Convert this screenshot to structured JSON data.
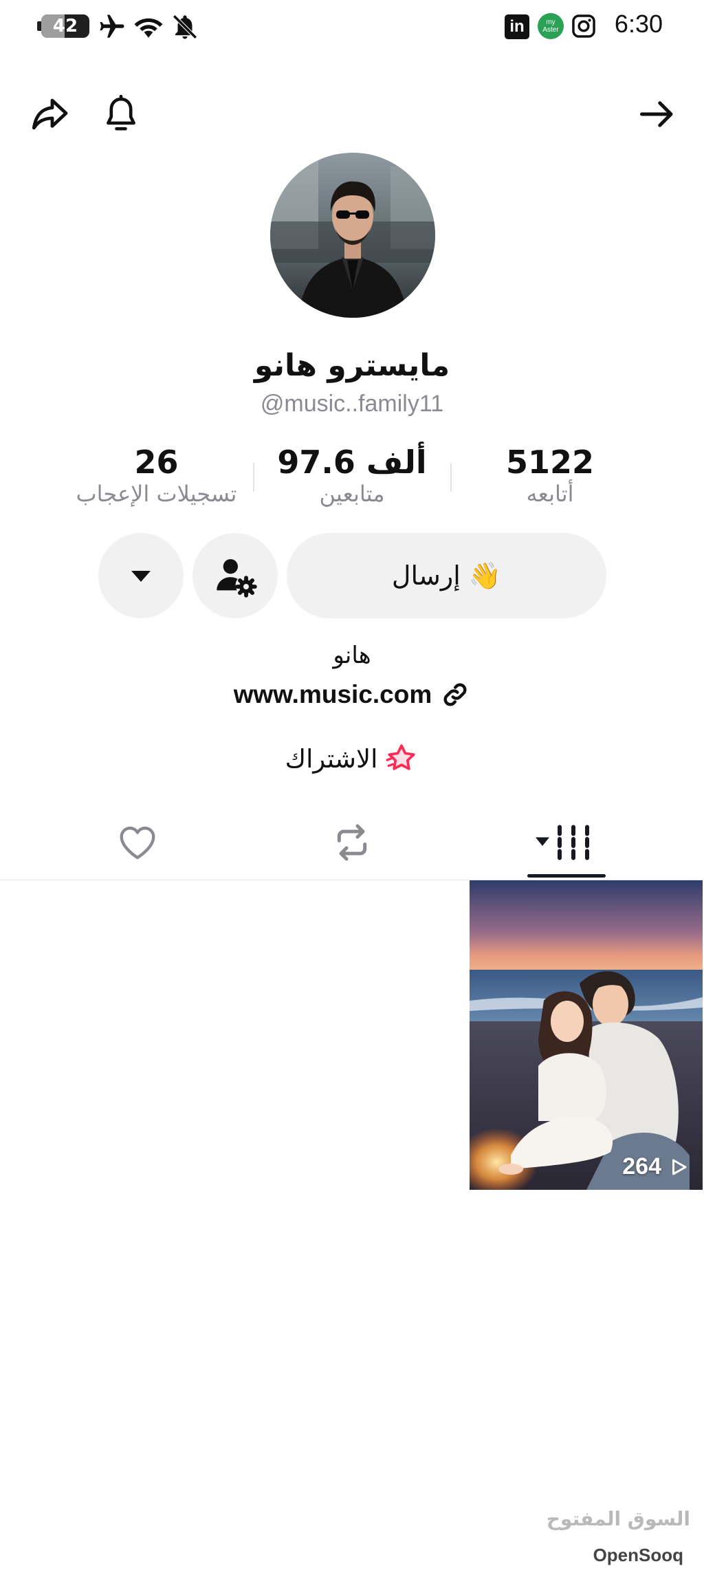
{
  "status_bar": {
    "battery": "42",
    "time": "6:30",
    "app_badge": "my Aster"
  },
  "profile": {
    "display_name": "مايسترو هانو",
    "handle": "@music..family11",
    "bio": "هانو",
    "website": "www.music.com",
    "subscription_label": "الاشتراك"
  },
  "stats": [
    {
      "value": "5122",
      "label": "أتابعه"
    },
    {
      "value": "97.6 ألف",
      "label": "متابعين"
    },
    {
      "value": "26",
      "label": "تسجيلات الإعجاب"
    }
  ],
  "actions": {
    "message_label": "إرسال 👋"
  },
  "videos": [
    {
      "views": "264"
    }
  ],
  "watermark": {
    "arabic": "السوق المفتوح",
    "english": "OpenSooq"
  },
  "colors": {
    "accent_pink": "#fe2c55",
    "button_bg": "#f1f1f2",
    "secondary_text": "#8a8b91"
  }
}
